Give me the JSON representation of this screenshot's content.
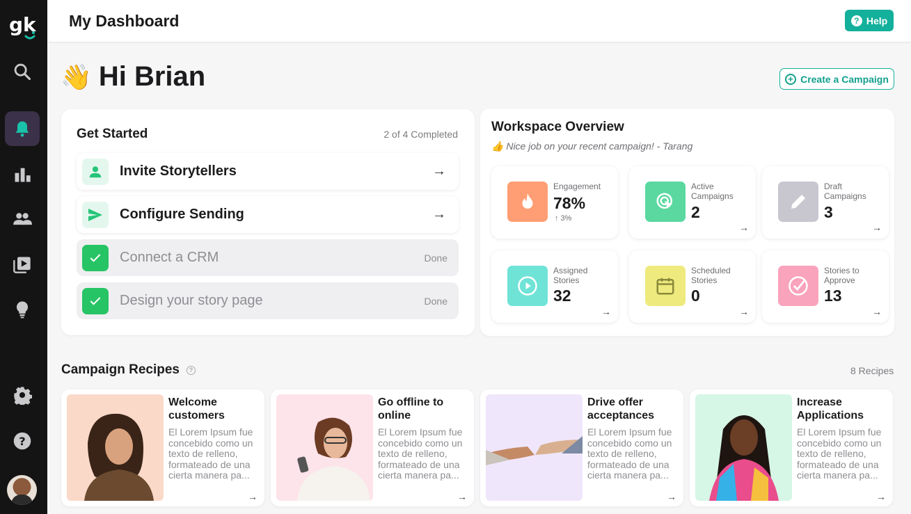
{
  "sidebar": {
    "logo": "gk",
    "items": [
      {
        "icon": "search-icon"
      },
      {
        "icon": "bell-icon",
        "active": true
      },
      {
        "icon": "bar-chart-icon"
      },
      {
        "icon": "people-icon"
      },
      {
        "icon": "video-library-icon"
      },
      {
        "icon": "lightbulb-icon"
      },
      {
        "icon": "gear-icon"
      },
      {
        "icon": "help-icon"
      }
    ]
  },
  "header": {
    "title": "My Dashboard",
    "help_label": "Help"
  },
  "greeting": {
    "emoji": "👋",
    "text": "Hi Brian"
  },
  "create_campaign_label": "Create a Campaign",
  "get_started": {
    "title": "Get Started",
    "progress": "2 of 4 Completed",
    "tasks": [
      {
        "label": "Invite Storytellers",
        "status": "todo"
      },
      {
        "label": "Configure Sending",
        "status": "todo"
      },
      {
        "label": "Connect a CRM",
        "status": "Done"
      },
      {
        "label": "Design your story page",
        "status": "Done"
      }
    ]
  },
  "workspace": {
    "title": "Workspace Overview",
    "subtitle_emoji": "👍",
    "subtitle": "Nice job on your recent campaign! - Tarang",
    "stats": [
      {
        "label": "Engagement",
        "value": "78%",
        "delta": "↑ 3%",
        "color": "#ff9e74"
      },
      {
        "label": "Active Campaigns",
        "value": "2",
        "color": "#5ad8a0"
      },
      {
        "label": "Draft Campaigns",
        "value": "3",
        "color": "#c8c6cf"
      },
      {
        "label": "Assigned Stories",
        "value": "32",
        "color": "#6fe3d6"
      },
      {
        "label": "Scheduled Stories",
        "value": "0",
        "color": "#eeea7e"
      },
      {
        "label": "Stories to Approve",
        "value": "13",
        "color": "#f9a3bd"
      }
    ]
  },
  "recipes": {
    "title": "Campaign Recipes",
    "count": "8 Recipes",
    "items": [
      {
        "title": "Welcome customers",
        "desc": "El Lorem Ipsum fue concebido como un texto de relleno, formateado de una cierta manera pa...",
        "bg": "#fbd9c8"
      },
      {
        "title": "Go offline to online",
        "desc": "El Lorem Ipsum fue concebido como un texto de relleno, formateado de una cierta manera pa...",
        "bg": "#fde3ea"
      },
      {
        "title": "Drive offer acceptances",
        "desc": "El Lorem Ipsum fue concebido como un texto de relleno, formateado de una cierta manera pa...",
        "bg": "#f0e6fb"
      },
      {
        "title": "Increase Applications",
        "desc": "El Lorem Ipsum fue concebido como un texto de relleno, formateado de una cierta manera pa...",
        "bg": "#d6f6e6"
      }
    ]
  }
}
